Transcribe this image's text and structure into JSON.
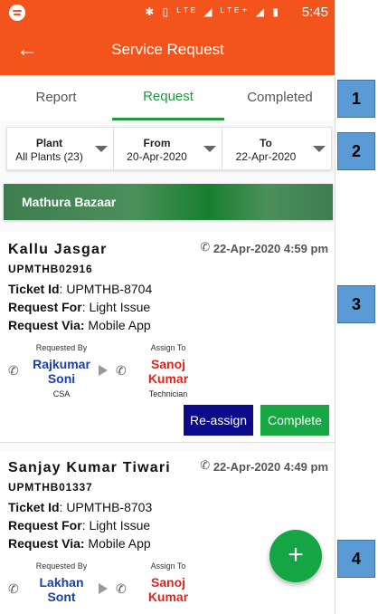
{
  "status_bar": {
    "time": "5:45",
    "icons": "✱ ▯ ᴸᵀᴱ ◢ ᴸᵀᴱ⁺ ◢ ▮"
  },
  "app_bar": {
    "title": "Service Request",
    "back_icon": "←"
  },
  "tabs": [
    {
      "label": "Report"
    },
    {
      "label": "Request",
      "active": true
    },
    {
      "label": "Completed"
    }
  ],
  "filters": [
    {
      "label": "Plant",
      "value": "All Plants (23)"
    },
    {
      "label": "From",
      "value": "20-Apr-2020"
    },
    {
      "label": "To",
      "value": "22-Apr-2020"
    }
  ],
  "banner": {
    "text": "Mathura Bazaar"
  },
  "requests": [
    {
      "name": "Kallu Jasgar",
      "code": "UPMTHB02916",
      "datetime": "22-Apr-2020 4:59 pm",
      "ticket_label": "Ticket Id",
      "ticket_id": ": UPMTHB-8704",
      "request_for_label": "Request For",
      "request_for": ": Light Issue",
      "request_via_label": "Request Via:",
      "request_via": " Mobile App",
      "requested_by_caption": "Requested By",
      "requested_by_name": "Rajkumar Soni",
      "requested_by_role": "CSA",
      "assign_to_caption": "Assign To",
      "assign_to_name": "Sanoj Kumar",
      "assign_to_role": "Technician",
      "reassign_label": "Re-assign",
      "complete_label": "Complete"
    },
    {
      "name": "Sanjay Kumar Tiwari",
      "code": "UPMTHB01337",
      "datetime": "22-Apr-2020 4:49 pm",
      "ticket_label": "Ticket Id",
      "ticket_id": ": UPMTHB-8703",
      "request_for_label": "Request For",
      "request_for": ": Light Issue",
      "request_via_label": "Request Via:",
      "request_via": " Mobile App",
      "requested_by_caption": "Requested By",
      "requested_by_name": "Lakhan Sont",
      "assign_to_caption": "Assign To",
      "assign_to_name": "Sanoj Kumar"
    }
  ],
  "fab": {
    "icon": "+"
  },
  "callouts": [
    "1",
    "2",
    "3",
    "4"
  ],
  "colors": {
    "brand": "#f2541b",
    "accent_green": "#1e9b3e",
    "name_blue": "#1a3fa6",
    "name_red": "#e2231a",
    "reassign": "#0a0a8a",
    "callout": "#5b9bd5"
  }
}
